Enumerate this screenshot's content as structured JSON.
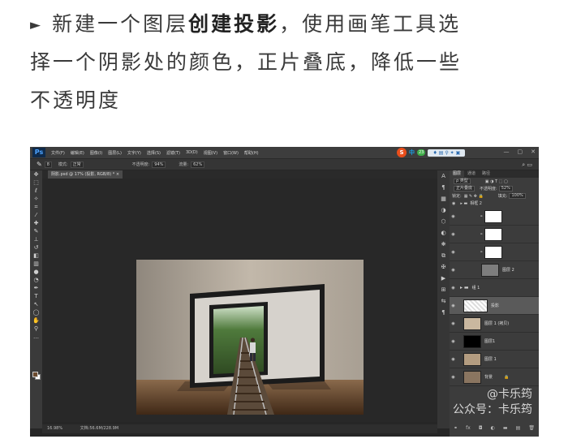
{
  "article": {
    "bullet": "►",
    "line1_pre": "新建一个图层",
    "line1_bold": "创建投影",
    "line1_post": "，使用画笔工具选",
    "line2": "择一个阴影处的颜色，正片叠底，降低一些",
    "line3": "不透明度"
  },
  "app": {
    "logo": "Ps",
    "menu": [
      "文件(F)",
      "编辑(E)",
      "图像(I)",
      "图层(L)",
      "文字(Y)",
      "选择(S)",
      "滤镜(T)",
      "3D(D)",
      "视图(V)",
      "窗口(W)",
      "帮助(H)"
    ],
    "tray": {
      "s_logo": "S",
      "ime": "中",
      "badge": "23",
      "icons": "♦ ▤ ⚲ ✦ ▣"
    },
    "window_controls": [
      "—",
      "▢",
      "✕"
    ]
  },
  "options": {
    "tool_icon": "✎",
    "brush_size": "8",
    "mode_label": "模式:",
    "mode_value": "正常",
    "opacity_label": "不透明度:",
    "opacity_value": "94%",
    "flow_label": "流量:",
    "flow_value": "62%"
  },
  "document": {
    "tab_label": "阴影.psd @ 17% (投影, RGB/8) * ×",
    "zoom": "16.98%",
    "doc_info": "文档:56.6M/228.9M"
  },
  "panel": {
    "tabs": [
      "图层",
      "通道",
      "路径"
    ],
    "filter_label": "ρ 类型",
    "blend_mode": "正片叠底",
    "opacity_label": "不透明度:",
    "opacity_value": "52%",
    "lock_label": "锁定:",
    "fill_label": "填充:",
    "fill_value": "100%",
    "group_name": "相框 2",
    "layers": [
      {
        "name": "",
        "kind": "adjust"
      },
      {
        "name": "",
        "kind": "adjust"
      },
      {
        "name": "",
        "kind": "adjust"
      },
      {
        "name": "图层 2",
        "kind": "photo"
      },
      {
        "name": "组 1",
        "kind": "group"
      },
      {
        "name": "投影",
        "kind": "shadow"
      },
      {
        "name": "图层 1 (拷贝)",
        "kind": "frame"
      },
      {
        "name": "图层1",
        "kind": "mask"
      },
      {
        "name": "图层 1",
        "kind": "frame"
      },
      {
        "name": "背景",
        "kind": "bg"
      }
    ],
    "footer_icons": [
      "⚭",
      "fx",
      "◘",
      "◐",
      "▬",
      "▤",
      "🗑"
    ]
  },
  "watermark": {
    "line1": "@卡乐筠",
    "line2": "公众号：卡乐筠"
  },
  "colors": {
    "ps_bg": "#262626",
    "panel": "#3c3c3c",
    "accent": "#4da3ff",
    "fg_swatch": "#6b4a2e"
  }
}
